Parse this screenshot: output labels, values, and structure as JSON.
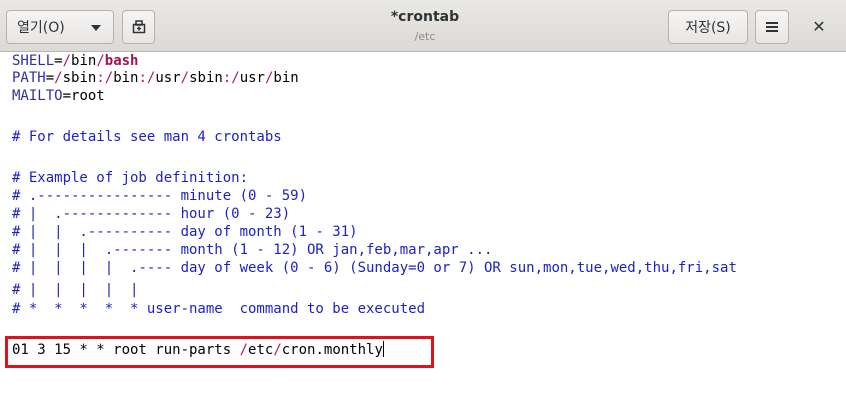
{
  "header": {
    "open_label": "열기(O)",
    "save_label": "저장(S)",
    "title": "*crontab",
    "subtitle": "/etc"
  },
  "editor": {
    "shell_key": "SHELL",
    "shell_eq": "=",
    "shell_slash1": "/",
    "shell_bin": "bin",
    "shell_slash2": "/",
    "shell_bash": "bash",
    "path_key": "PATH",
    "path_eq": "=",
    "path_s1": "/",
    "path_sbin": "sbin",
    "path_c1": ":",
    "path_s2": "/",
    "path_bin": "bin",
    "path_c2": ":",
    "path_s3": "/",
    "path_usr1": "usr",
    "path_s4": "/",
    "path_sbin2": "sbin",
    "path_c3": ":",
    "path_s5": "/",
    "path_usr2": "usr",
    "path_s6": "/",
    "path_bin2": "bin",
    "mailto_key": "MAILTO",
    "mailto_eq": "=",
    "mailto_val": "root",
    "comment_details": "# For details see man 4 crontabs",
    "comment_example": "# Example of job definition:",
    "comment_minute": "# .---------------- minute (0 - 59)",
    "comment_hour": "# |  .------------- hour (0 - 23)",
    "comment_dom": "# |  |  .---------- day of month (1 - 31)",
    "comment_month": "# |  |  |  .------- month (1 - 12) OR jan,feb,mar,apr ...",
    "comment_dow": "# |  |  |  |  .---- day of week (0 - 6) (Sunday=0 or 7) OR sun,mon,tue,wed,thu,fri,sat",
    "comment_bars": "# |  |  |  |  |",
    "comment_cmd": "# *  *  *  *  * user-name  command to be executed",
    "job_pre": "01 3 15 * * root run-parts ",
    "job_s1": "/",
    "job_etc": "etc",
    "job_s2": "/",
    "job_post": "cron.monthly"
  }
}
